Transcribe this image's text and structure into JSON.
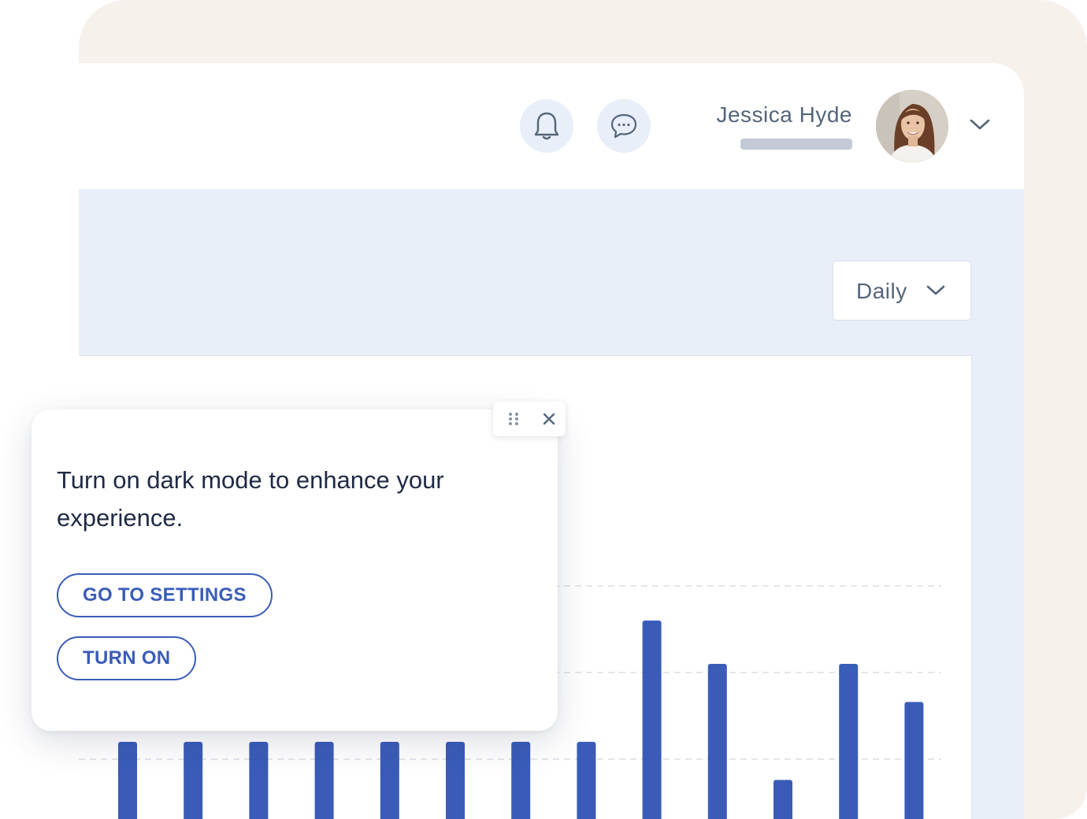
{
  "header": {
    "user_name": "Jessica Hyde",
    "notifications_icon": "bell-icon",
    "messages_icon": "chat-bubble-icon",
    "menu_icon": "chevron-down-icon"
  },
  "filters": {
    "period": {
      "selected": "Daily",
      "icon": "chevron-down-icon"
    }
  },
  "popup": {
    "message": "Turn on dark mode to enhance your experience.",
    "primary_action": "GO TO SETTINGS",
    "secondary_action": "TURN ON",
    "drag_icon": "drag-handle-icon",
    "close_icon": "close-icon"
  },
  "colors": {
    "accent": "#3a5cb8",
    "bar": "#3a5cb8",
    "panel_bg": "#e8eff8",
    "backdrop": "#f6f1eb",
    "text_muted": "#55657a",
    "text_dark": "#1f2a44"
  },
  "chart_data": {
    "type": "bar",
    "values": [
      50,
      50,
      50,
      50,
      50,
      50,
      50,
      50,
      120,
      95,
      28,
      95,
      73
    ],
    "gridlines": [
      40,
      90,
      140
    ],
    "ylim": [
      0,
      150
    ],
    "grid": true
  }
}
